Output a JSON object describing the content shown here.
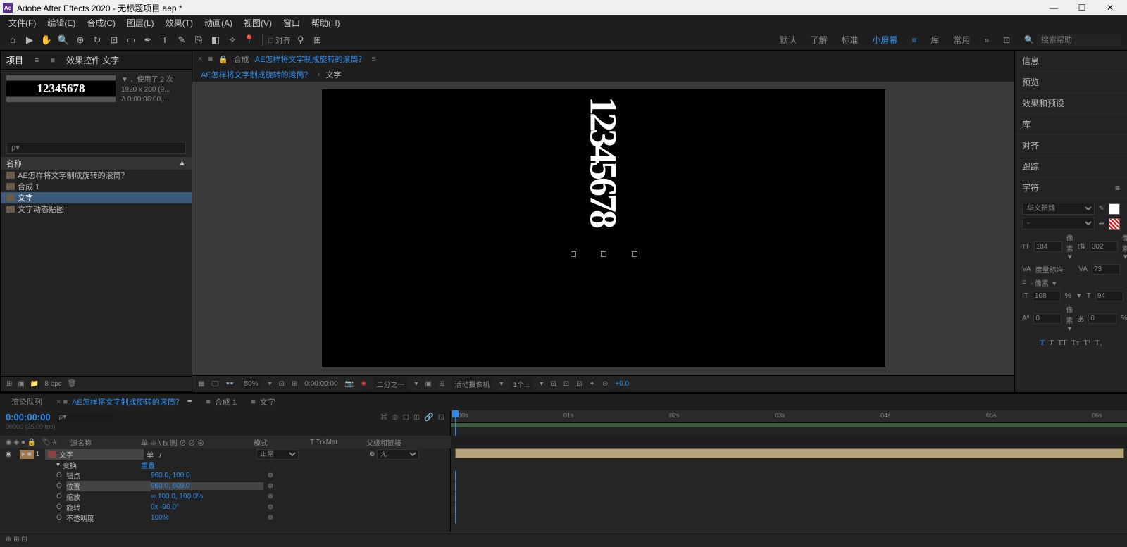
{
  "titlebar": {
    "app_icon": "Ae",
    "title": "Adobe After Effects 2020 - 无标题项目.aep *"
  },
  "menubar": [
    "文件(F)",
    "编辑(E)",
    "合成(C)",
    "图层(L)",
    "效果(T)",
    "动画(A)",
    "视图(V)",
    "窗口",
    "帮助(H)"
  ],
  "toolbar": {
    "snap": "□ 对齐",
    "workspaces": [
      "默认",
      "了解",
      "标准",
      "小屏幕",
      "库",
      "常用"
    ],
    "active_workspace": "小屏幕",
    "search_placeholder": "搜索帮助"
  },
  "project_panel": {
    "tabs": [
      "项目",
      "效果控件 文字"
    ],
    "info_lines": [
      "▼ ，使用了 2 次",
      "1920 x 200 (9...",
      "Δ 0:00:06:00,..."
    ],
    "thumb_text": "12345678",
    "search_placeholder": "ρ▾",
    "col_header": "名称",
    "items": [
      {
        "name": "AE怎样将文字制成旋转的滚筒？",
        "sel": false
      },
      {
        "name": "合成 1",
        "sel": false
      },
      {
        "name": "文字",
        "sel": true
      },
      {
        "name": "文字动态贴图",
        "sel": false
      }
    ],
    "footer_bpc": "8 bpc"
  },
  "composition": {
    "lock": "🔒",
    "label": "合成",
    "name": "AE怎样将文字制成旋转的滚筒？",
    "crumb": [
      "AE怎样将文字制成旋转的滚筒？",
      "文字"
    ],
    "canvas_text": "12345678",
    "footer": {
      "zoom": "50%",
      "time": "0:00:00:00",
      "res": "二分之一",
      "camera": "活动摄像机",
      "views": "1个...",
      "exposure": "+0.0"
    }
  },
  "right_panels": {
    "sections": [
      "信息",
      "预览",
      "效果和预设",
      "库",
      "对齐",
      "跟踪"
    ],
    "char_title": "字符",
    "font": "华文新魏",
    "font_size": "184",
    "leading": "302",
    "kerning": "度量标准",
    "tracking": "73",
    "stroke_unit": "- 像素 ▼",
    "vscale": "108",
    "hscale": "94",
    "baseline": "0",
    "tsume": "0",
    "size_unit": "像素 ▼",
    "pct": "%"
  },
  "timeline": {
    "tabs": [
      {
        "name": "渲染队列",
        "active": false
      },
      {
        "name": "AE怎样将文字制成旋转的滚筒？",
        "active": true,
        "comp": true
      },
      {
        "name": "合成 1",
        "active": false
      },
      {
        "name": "文字",
        "active": false
      }
    ],
    "current_time": "0:00:00:00",
    "fps_label": "00000 (25.00 fps)",
    "search_placeholder": "ρ▾",
    "cols": {
      "source": "源名称",
      "switches": "单 ※ \\ fx 圓 ⊘ ⊘ ⊕",
      "mode": "模式",
      "trkmat": "T  TrkMat",
      "parent": "父级和链接"
    },
    "ruler_ticks": [
      "00s",
      "01s",
      "02s",
      "03s",
      "04s",
      "05s",
      "06s"
    ],
    "layer": {
      "num": "1",
      "name": "文字",
      "mode": "正常",
      "trkmat": "",
      "parent": "无",
      "transform_label": "变换",
      "transform_reset": "重置",
      "props": [
        {
          "name": "锚点",
          "val": "960.0, 100.0"
        },
        {
          "name": "位置",
          "val": "960.0, 609.0",
          "hl": true
        },
        {
          "name": "缩放",
          "val": "∞ 100.0, 100.0%"
        },
        {
          "name": "旋转",
          "val": "0x -90.0°"
        },
        {
          "name": "不透明度",
          "val": "100%"
        }
      ]
    }
  }
}
